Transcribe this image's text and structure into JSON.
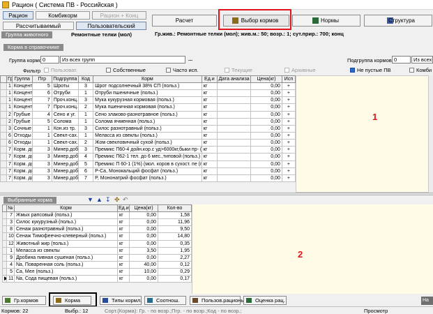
{
  "window": {
    "title": "Рацион ( Система ПВ - Российская )"
  },
  "top_tabs": {
    "ration": "Рацион",
    "kombikorm": "Комбикорм",
    "ration_konc": "Рацион + Конц",
    "calculated": "Рассчитываемый",
    "user": "Пользовательский"
  },
  "toolbar": {
    "calc": "Расчет",
    "feed_select": "Выбор кормов",
    "norms": "Нормы",
    "structure": "Структура"
  },
  "info_line": "Гр.жив.: Ремонтные телки (мол); жив.м.: 50; возр.: 1; сут.прир.: 700; конц",
  "group": {
    "label": "Группа животного",
    "value": "Ремонтные телки (мол)"
  },
  "reference": {
    "header": "Корма в справочнике",
    "group_label": "Группа кормов",
    "group_code": "0",
    "group_value": "Из всех групп",
    "ellipsis": "...",
    "subgroup_label": "Подгруппа кормов",
    "subgroup_code": "0",
    "subgroup_value": "Из всех под",
    "filter_label": "Фильтр",
    "filters": [
      {
        "label": "Пользоват.",
        "checked": false,
        "disabled": true
      },
      {
        "label": "Собственные",
        "checked": false,
        "disabled": false
      },
      {
        "label": "Часто исп.",
        "checked": false,
        "disabled": false
      },
      {
        "label": "Текущие",
        "checked": false,
        "disabled": true
      },
      {
        "label": "Архивные",
        "checked": false,
        "disabled": true
      },
      {
        "label": "Не пустые ПВ",
        "checked": true,
        "disabled": false
      },
      {
        "label": "Комби",
        "checked": false,
        "disabled": false
      }
    ],
    "columns": [
      "Гр.",
      "Группа",
      "Пгр",
      "Подгруппа",
      "Код",
      "Корм",
      "Ед.и",
      "Дата анализа",
      "Цена(кг)",
      "Исп"
    ],
    "rows": [
      [
        "1",
        "Концентр.",
        "5",
        "Шроты",
        "3",
        "Шрот подсолнечный 38% СП (польз.)",
        "кг",
        "",
        "0,00",
        "+"
      ],
      [
        "1",
        "Концентр.",
        "6",
        "Отруби",
        "1",
        "Отруби пшеничные (польз.)",
        "кг",
        "",
        "0,00",
        "+"
      ],
      [
        "1",
        "Концентр.",
        "7",
        "Проч.конц.",
        "3",
        "Мука кукурузная кормовая (польз.)",
        "кг",
        "",
        "0,00",
        "+"
      ],
      [
        "1",
        "Концентр.",
        "7",
        "Проч.конц.",
        "2",
        "Мука пшеничная кормовая (польз.)",
        "кг",
        "",
        "0,00",
        "+"
      ],
      [
        "2",
        "Грубые",
        "4",
        "Сено и уг.",
        "1",
        "Сено злаково-разнотравное (польз.)",
        "кг",
        "",
        "0,00",
        "+"
      ],
      [
        "2",
        "Грубые",
        "5",
        "Солома",
        "1",
        "Солома ячменная (польз.)",
        "кг",
        "",
        "0,00",
        "+"
      ],
      [
        "3",
        "Сочные",
        "1",
        "Кон.из тр.",
        "3",
        "Силос разнотравный (польз.)",
        "кг",
        "",
        "0,00",
        "+"
      ],
      [
        "6",
        "Отходы пр.",
        "1",
        "Свекл-сах.",
        "1",
        "Меласса из свеклы (польз.)",
        "кг",
        "",
        "0,00",
        "+"
      ],
      [
        "6",
        "Отходы пр.",
        "1",
        "Свекл-сах.",
        "2",
        "Жом свекловичный сухой (польз.)",
        "кг",
        "",
        "0,00",
        "+"
      ],
      [
        "7",
        "Корм. доб.",
        "3",
        "Минер.доб.",
        "3",
        "Премикс П60-4 дойн.кор.с уд>6000кг,быки пр- (польз)",
        "кг",
        "",
        "0,00",
        "+"
      ],
      [
        "7",
        "Корм. доб.",
        "3",
        "Минер.доб.",
        "4",
        "Премикс П62-1 тел. до 6 мес.,типовой (польз.)",
        "кг",
        "",
        "0,00",
        "+"
      ],
      [
        "7",
        "Корм. доб.",
        "3",
        "Минер.доб.",
        "5",
        "Премикс П 60-1 (1%) (мол. коров в сухост. пе (польз.",
        "кг",
        "",
        "0,00",
        "+"
      ],
      [
        "7",
        "Корм. доб.",
        "3",
        "Минер.доб.",
        "6",
        "P-Ca, Монокальций фосфат (польз.)",
        "кг",
        "",
        "0,00",
        "+"
      ],
      [
        "7",
        "Корм. доб.",
        "3",
        "Минер.доб.",
        "7",
        "P, Мононатрий фосфат (польз.)",
        "кг",
        "",
        "0,00",
        "+"
      ]
    ]
  },
  "selected": {
    "header": "Выбранные корма",
    "columns": [
      "№",
      "Корм",
      "Ед.и",
      "Цена(кг)",
      "Кол-во"
    ],
    "rows": [
      [
        "7",
        "Жмых рапсовый (польз.)",
        "кг",
        "0,00",
        "1,58"
      ],
      [
        "3",
        "Силос кукурузный (польз.)",
        "кг",
        "0,00",
        "11,96"
      ],
      [
        "8",
        "Сенаж разнотравный (польз.)",
        "кг",
        "0,00",
        "9,50"
      ],
      [
        "10",
        "Сенаж Тимофеечно-клеверный (польз.)",
        "кг",
        "0,00",
        "14,80"
      ],
      [
        "12",
        "Животный жир (польз.)",
        "кг",
        "0,00",
        "0,35"
      ],
      [
        "1",
        "Меласса из свеклы",
        "кг",
        "3,50",
        "1,95"
      ],
      [
        "9",
        "Дробина пивная сушеная (польз.)",
        "кг",
        "0,00",
        "2,27"
      ],
      [
        "4",
        "Na, Поваренная соль (польз.)",
        "кг",
        "40,00",
        "0,12"
      ],
      [
        "5",
        "Ca, Мел (польз.)",
        "кг",
        "10,00",
        "0,29"
      ],
      [
        "11",
        "Na, Сода пищевая (польз.)",
        "кг",
        "0,00",
        "0,17"
      ]
    ]
  },
  "markers": {
    "one": "1",
    "two": "2"
  },
  "bottom_tabs": [
    "Гр.кормов",
    "Корма",
    "Типы кормл.",
    "Соотнош.",
    "Пользов.рационы",
    "Оценка рац."
  ],
  "bottom_right": "Нa",
  "status": {
    "count": "Кормов: 22",
    "selected": "Выбр.: 12",
    "sort": "Сорт.(Корма): Гр. - по возр.;Пгр. - по возр.;Код - по возр.;",
    "mode": "Просмотр"
  },
  "colors": {
    "accent_red": "#e0141d",
    "grid_bg_yellow": "#fffbe6",
    "checkbox_checked": "#2a6ad0"
  }
}
